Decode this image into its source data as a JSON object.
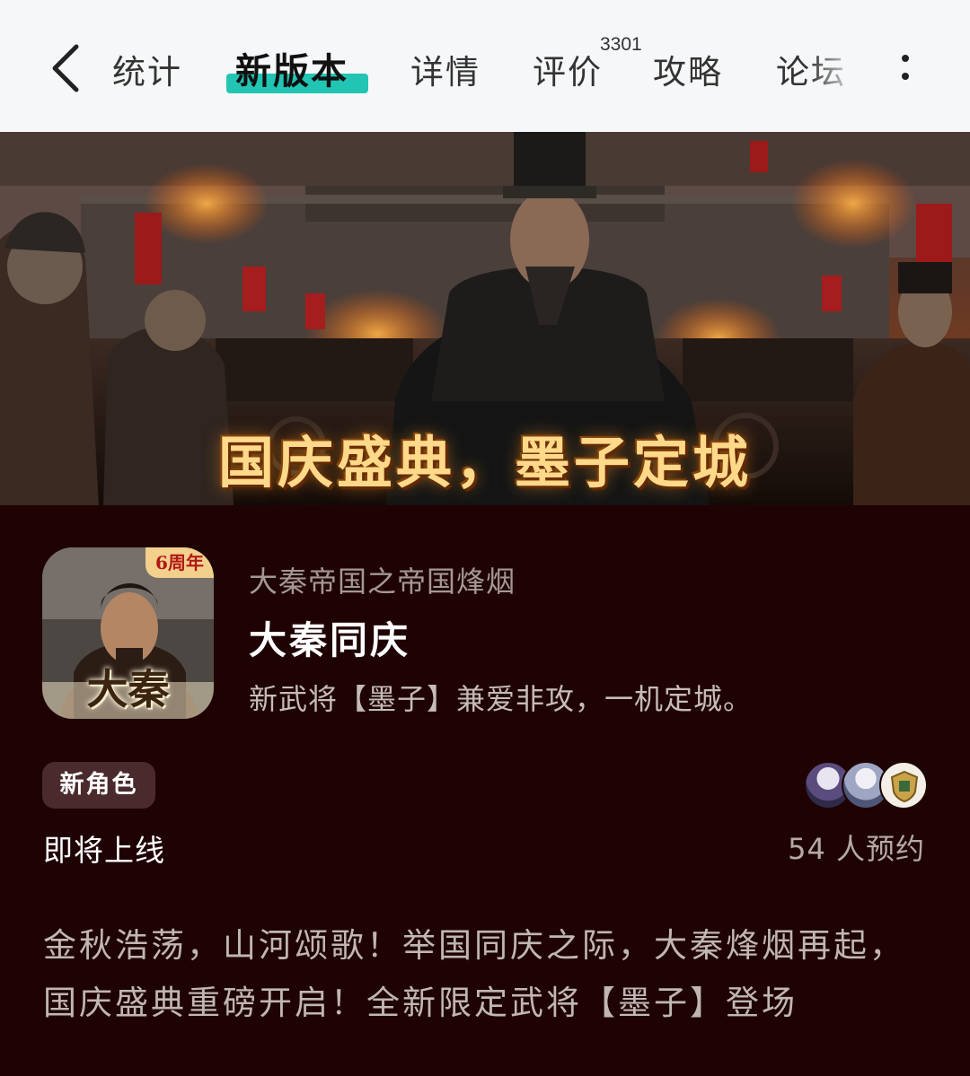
{
  "nav": {
    "back_icon": "back-chevron-icon",
    "tabs": [
      {
        "label": "统计",
        "active": false
      },
      {
        "label": "新版本",
        "active": true
      },
      {
        "label": "详情",
        "active": false
      },
      {
        "label": "评价",
        "active": false,
        "badge": "3301"
      },
      {
        "label": "攻略",
        "active": false
      },
      {
        "label": "论坛",
        "active": false
      }
    ],
    "more_icon": "more-vertical-icon",
    "accent_color": "#22c5b4"
  },
  "banner": {
    "title": "国庆盛典，墨子定城"
  },
  "game": {
    "icon_badge": "6周年",
    "icon_text": "大秦",
    "subtitle": "大秦帝国之帝国烽烟",
    "title": "大秦同庆",
    "description": "新武将【墨子】兼爱非攻，一机定城。"
  },
  "status": {
    "tag": "新角色",
    "state": "即将上线",
    "reserve_count": "54 人预约"
  },
  "intro_text": "金秋浩荡，山河颂歌！举国同庆之际，大秦烽烟再起，国庆盛典重磅开启！全新限定武将【墨子】登场",
  "colors": {
    "page_background": "#1f0204",
    "topbar_background": "#f6f7f8"
  }
}
